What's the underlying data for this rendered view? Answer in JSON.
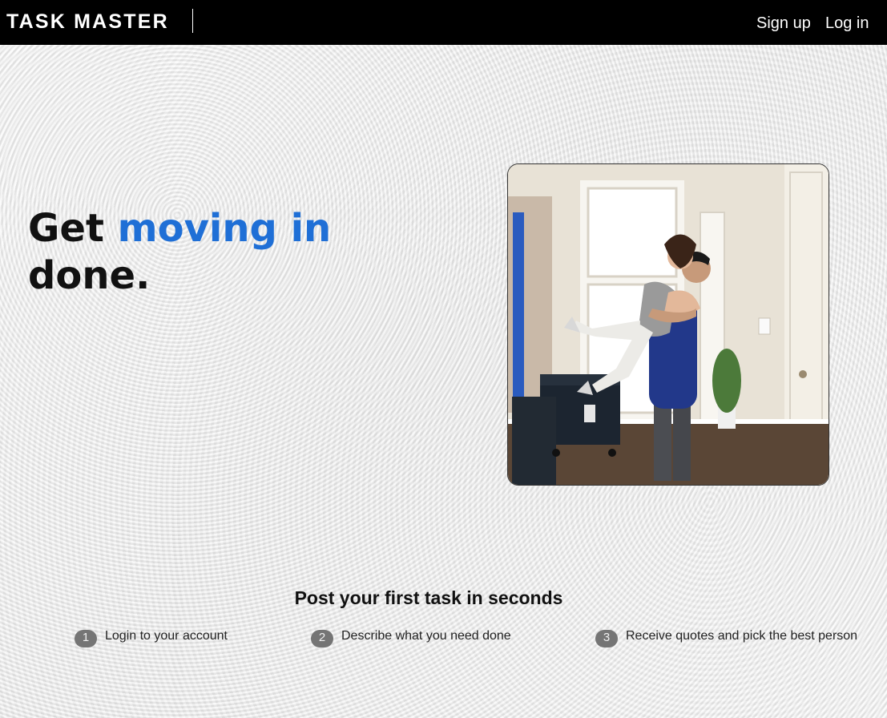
{
  "header": {
    "brand": "TASK MASTER",
    "signup_label": "Sign up",
    "login_label": "Log in"
  },
  "hero": {
    "title_prefix": "Get",
    "title_accent": "moving in",
    "title_suffix": "done.",
    "accent_color": "#1f6fd6",
    "image_icon": "couple-moving-in-photo"
  },
  "steps": {
    "heading": "Post your first task in seconds",
    "items": [
      {
        "number": "1",
        "text": "Login to your account"
      },
      {
        "number": "2",
        "text": "Describe what you need done"
      },
      {
        "number": "3",
        "text": "Receive quotes and pick the best person"
      }
    ]
  }
}
